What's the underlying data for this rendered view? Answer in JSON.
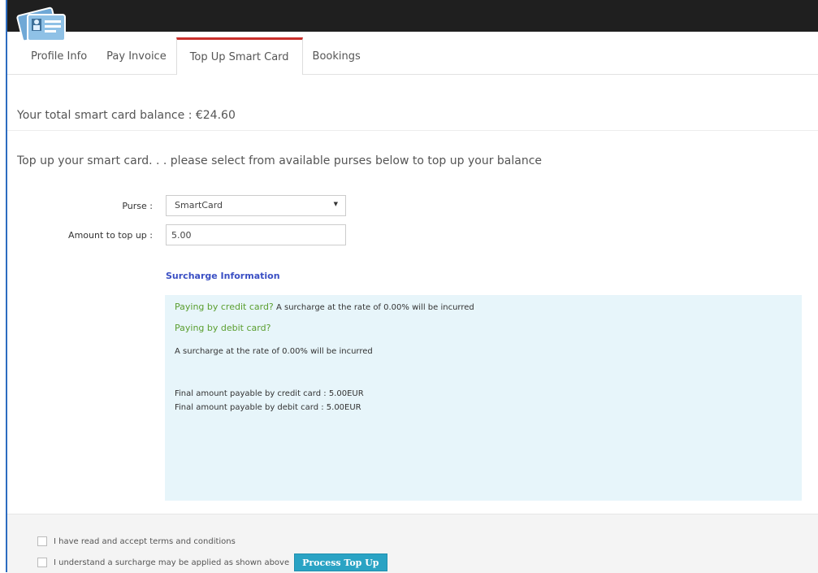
{
  "tabs": [
    {
      "label": "Profile Info"
    },
    {
      "label": "Pay Invoice"
    },
    {
      "label": "Top Up Smart Card"
    },
    {
      "label": "Bookings"
    }
  ],
  "balance_text": "Your total smart card balance : €24.60",
  "instruction_text": "Top up your smart card. . . please select from available purses below to top up your balance",
  "form": {
    "purse_label": "Purse :",
    "purse_value": "SmartCard",
    "amount_label": "Amount to top up :",
    "amount_value": "5.00"
  },
  "surcharge": {
    "heading": "Surcharge Information",
    "credit_question": "Paying by credit card?",
    "credit_text": "A surcharge at the rate of 0.00% will be incurred",
    "debit_question": "Paying by debit card?",
    "debit_text": "A surcharge at the rate of 0.00% will be incurred",
    "final_credit": "Final amount payable by credit card : 5.00EUR",
    "final_debit": "Final amount payable by debit card : 5.00EUR"
  },
  "footer": {
    "terms_label": "I have read and accept terms and conditions",
    "surcharge_label": "I understand a surcharge may be applied as shown above",
    "process_button": "Process Top Up"
  },
  "colors": {
    "active_tab_accent": "#c9302c",
    "surcharge_heading": "#3a4fc4",
    "question_green": "#5a9e2f",
    "panel_bg": "#e7f5fa",
    "button_bg": "#2aa3c4"
  },
  "icons": {
    "logo": "id-card-icon"
  }
}
